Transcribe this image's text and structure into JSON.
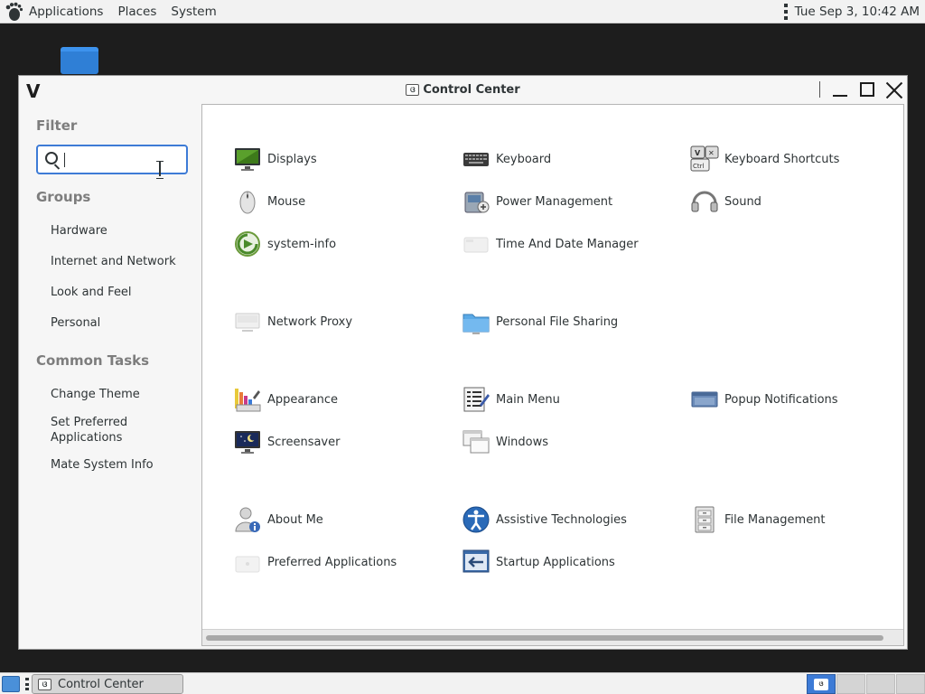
{
  "top_panel": {
    "menus": [
      "Applications",
      "Places",
      "System"
    ],
    "clock": "Tue Sep  3, 10:42 AM"
  },
  "window": {
    "title": "Control Center",
    "title_icon_text": "ଓ"
  },
  "sidebar": {
    "filter_heading": "Filter",
    "search_value": "",
    "groups_heading": "Groups",
    "groups": [
      "Hardware",
      "Internet and Network",
      "Look and Feel",
      "Personal"
    ],
    "tasks_heading": "Common Tasks",
    "tasks": [
      "Change Theme",
      "Set Preferred Applications",
      "Mate System Info"
    ]
  },
  "applets": [
    {
      "label": "Displays",
      "icon": "display-icon"
    },
    {
      "label": "Keyboard",
      "icon": "keyboard-icon"
    },
    {
      "label": "Keyboard Shortcuts",
      "icon": "keyboard-shortcuts-icon"
    },
    {
      "label": "Mouse",
      "icon": "mouse-icon"
    },
    {
      "label": "Power Management",
      "icon": "power-management-icon"
    },
    {
      "label": "Sound",
      "icon": "sound-icon"
    },
    {
      "label": "system-info",
      "icon": "system-info-icon"
    },
    {
      "label": "Time And Date Manager",
      "icon": "time-date-icon"
    },
    {
      "label": "Network Proxy",
      "icon": "network-proxy-icon"
    },
    {
      "label": "Personal File Sharing",
      "icon": "file-sharing-folder-icon"
    },
    {
      "label": "Appearance",
      "icon": "appearance-icon"
    },
    {
      "label": "Main Menu",
      "icon": "main-menu-icon"
    },
    {
      "label": "Popup Notifications",
      "icon": "popup-notifications-icon"
    },
    {
      "label": "Screensaver",
      "icon": "screensaver-icon"
    },
    {
      "label": "Windows",
      "icon": "windows-icon"
    },
    {
      "label": "About Me",
      "icon": "about-me-icon"
    },
    {
      "label": "Assistive Technologies",
      "icon": "accessibility-icon"
    },
    {
      "label": "File Management",
      "icon": "file-management-icon"
    },
    {
      "label": "Preferred Applications",
      "icon": "preferred-applications-icon"
    },
    {
      "label": "Startup Applications",
      "icon": "startup-applications-icon"
    }
  ],
  "bottom_panel": {
    "task_label": "Control Center"
  },
  "colors": {
    "accent": "#3d7bd6",
    "panel_bg": "#f2f2f2",
    "desktop_bg": "#1d1d1d"
  }
}
